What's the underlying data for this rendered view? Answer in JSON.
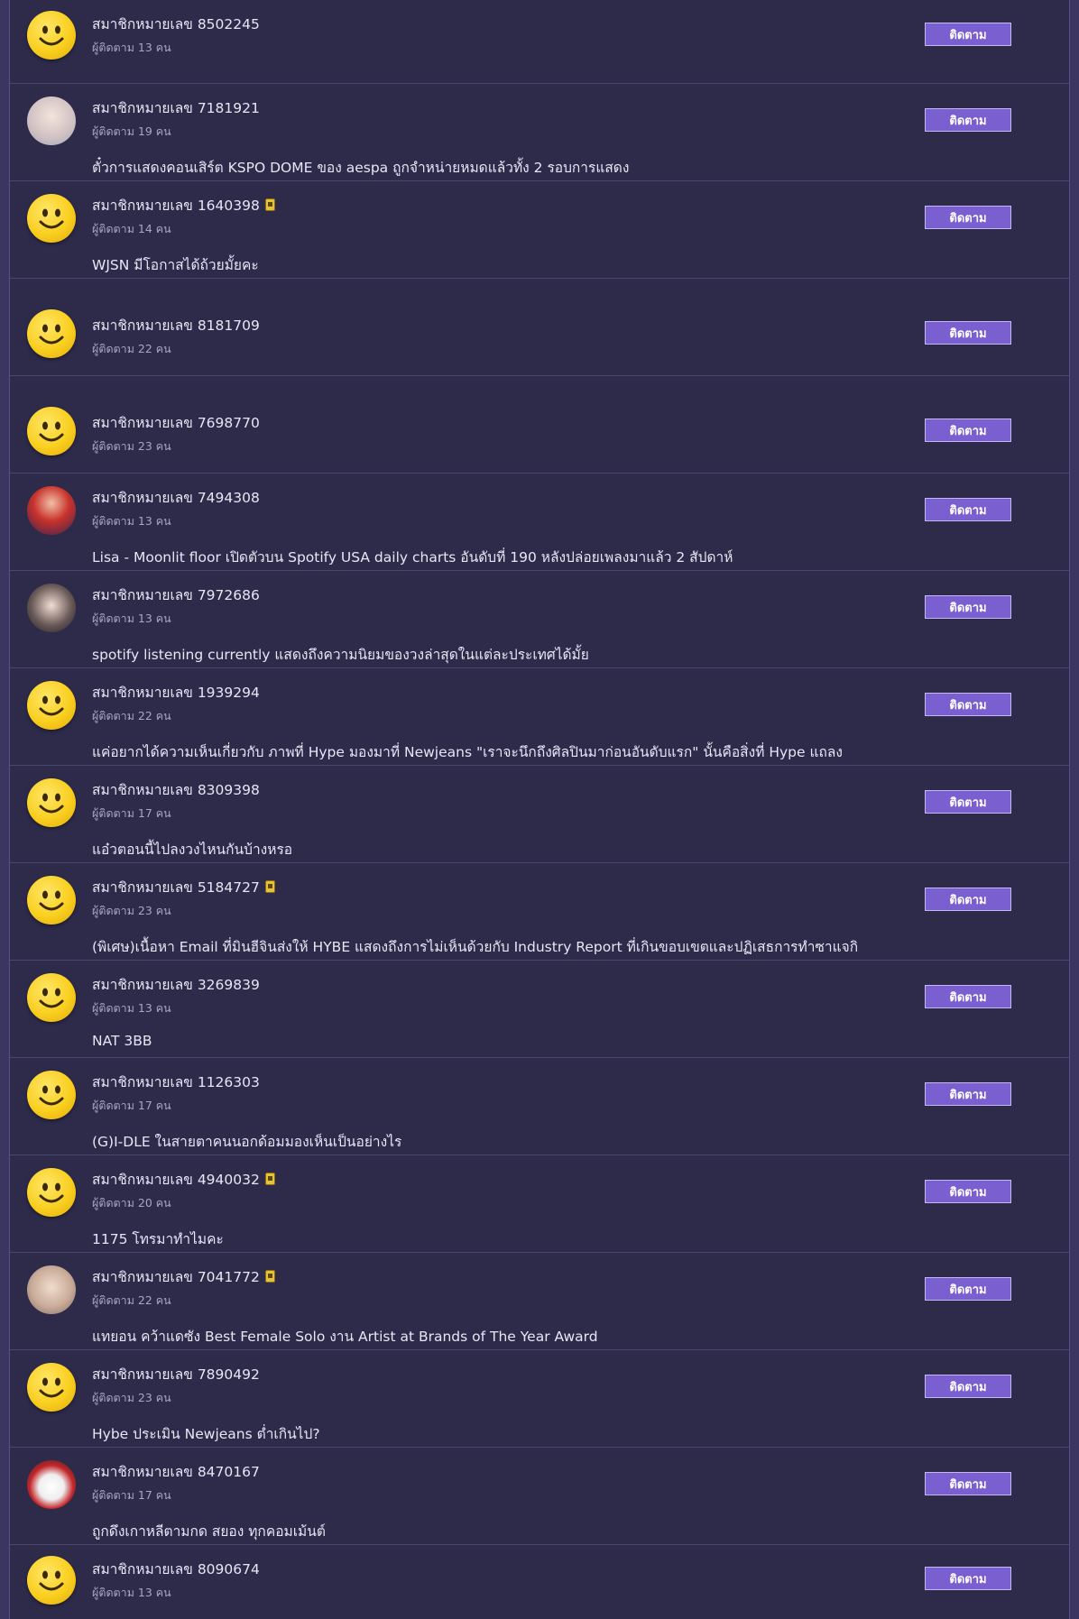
{
  "follow_label": "ติดตาม",
  "rows": [
    {
      "name": "สมาชิกหมายเลข 8502245",
      "followers": "ผู้ติดตาม 13 คน",
      "title": "",
      "avatar": "smiley",
      "badge": false
    },
    {
      "name": "สมาชิกหมายเลข 7181921",
      "followers": "ผู้ติดตาม 19 คน",
      "title": "ตั๋วการแสดงคอนเสิร์ต KSPO DOME ของ aespa ถูกจำหน่ายหมดแล้วทั้ง 2 รอบการแสดง",
      "avatar": "photo-1",
      "badge": false
    },
    {
      "name": "สมาชิกหมายเลข 1640398",
      "followers": "ผู้ติดตาม 14 คน",
      "title": "WJSN มีโอกาสได้ถ้วยมั้ยคะ",
      "avatar": "smiley",
      "badge": true
    },
    {
      "name": "สมาชิกหมายเลข 8181709",
      "followers": "ผู้ติดตาม 22 คน",
      "title": "",
      "avatar": "smiley",
      "badge": false
    },
    {
      "name": "สมาชิกหมายเลข 7698770",
      "followers": "ผู้ติดตาม 23 คน",
      "title": "",
      "avatar": "smiley",
      "badge": false
    },
    {
      "name": "สมาชิกหมายเลข 7494308",
      "followers": "ผู้ติดตาม 13 คน",
      "title": "Lisa - Moonlit floor เปิดตัวบน Spotify USA daily charts อันดับที่ 190 หลังปล่อยเพลงมาแล้ว 2 สัปดาห์",
      "avatar": "photo-2",
      "badge": false
    },
    {
      "name": "สมาชิกหมายเลข 7972686",
      "followers": "ผู้ติดตาม 13 คน",
      "title": "spotify listening currently แสดงถึงความนิยมของวงล่าสุดในแต่ละประเทศได้มั้ย",
      "avatar": "photo-3",
      "badge": false
    },
    {
      "name": "สมาชิกหมายเลข 1939294",
      "followers": "ผู้ติดตาม 22 คน",
      "title": "แค่อยากได้ความเห็นเกี่ยวกับ ภาพที่ Hype มองมาที่ Newjeans \"เราจะนึกถึงศิลปินมาก่อนอันดับแรก\" นั้นคือสิ่งที่ Hype แถลง",
      "avatar": "smiley",
      "badge": false
    },
    {
      "name": "สมาชิกหมายเลข 8309398",
      "followers": "ผู้ติดตาม 17 คน",
      "title": "แอ๋วตอนนี้ไปลงวงไหนกันบ้างหรอ",
      "avatar": "smiley",
      "badge": false
    },
    {
      "name": "สมาชิกหมายเลข 5184727",
      "followers": "ผู้ติดตาม 23 คน",
      "title": "(พิเศษ)เนื้อหา Email ที่มินฮีจินส่งให้ HYBE แสดงถึงการไม่เห็นด้วยกับ Industry Report ที่เกินขอบเขตและปฏิเสธการทำซาแจกิ",
      "avatar": "smiley",
      "badge": true
    },
    {
      "name": "สมาชิกหมายเลข 3269839",
      "followers": "ผู้ติดตาม 13 คน",
      "title": "NAT 3BB",
      "avatar": "smiley",
      "badge": false
    },
    {
      "name": "สมาชิกหมายเลข 1126303",
      "followers": "ผู้ติดตาม 17 คน",
      "title": "(G)I-DLE ในสายตาคนนอกด้อมมองเห็นเป็นอย่างไร",
      "avatar": "smiley",
      "badge": false
    },
    {
      "name": "สมาชิกหมายเลข 4940032",
      "followers": "ผู้ติดตาม 20 คน",
      "title": "1175 โทรมาทำไมคะ",
      "avatar": "smiley",
      "badge": true
    },
    {
      "name": "สมาชิกหมายเลข 7041772",
      "followers": "ผู้ติดตาม 22 คน",
      "title": "แทยอน คว้าแดซัง Best Female Solo งาน Artist at Brands of The Year Award",
      "avatar": "photo-4",
      "badge": true
    },
    {
      "name": "สมาชิกหมายเลข 7890492",
      "followers": "ผู้ติดตาม 23 คน",
      "title": "Hybe ประเมิน Newjeans ต่ำเกินไป?",
      "avatar": "smiley",
      "badge": false
    },
    {
      "name": "สมาชิกหมายเลข 8470167",
      "followers": "ผู้ติดตาม 17 คน",
      "title": "ถูกดึงเกาหลีตามกด สยอง ทุกคอมเม้นต์",
      "avatar": "photo-5",
      "badge": false
    },
    {
      "name": "สมาชิกหมายเลข 8090674",
      "followers": "ผู้ติดตาม 13 คน",
      "title": "",
      "avatar": "smiley",
      "badge": false
    }
  ]
}
